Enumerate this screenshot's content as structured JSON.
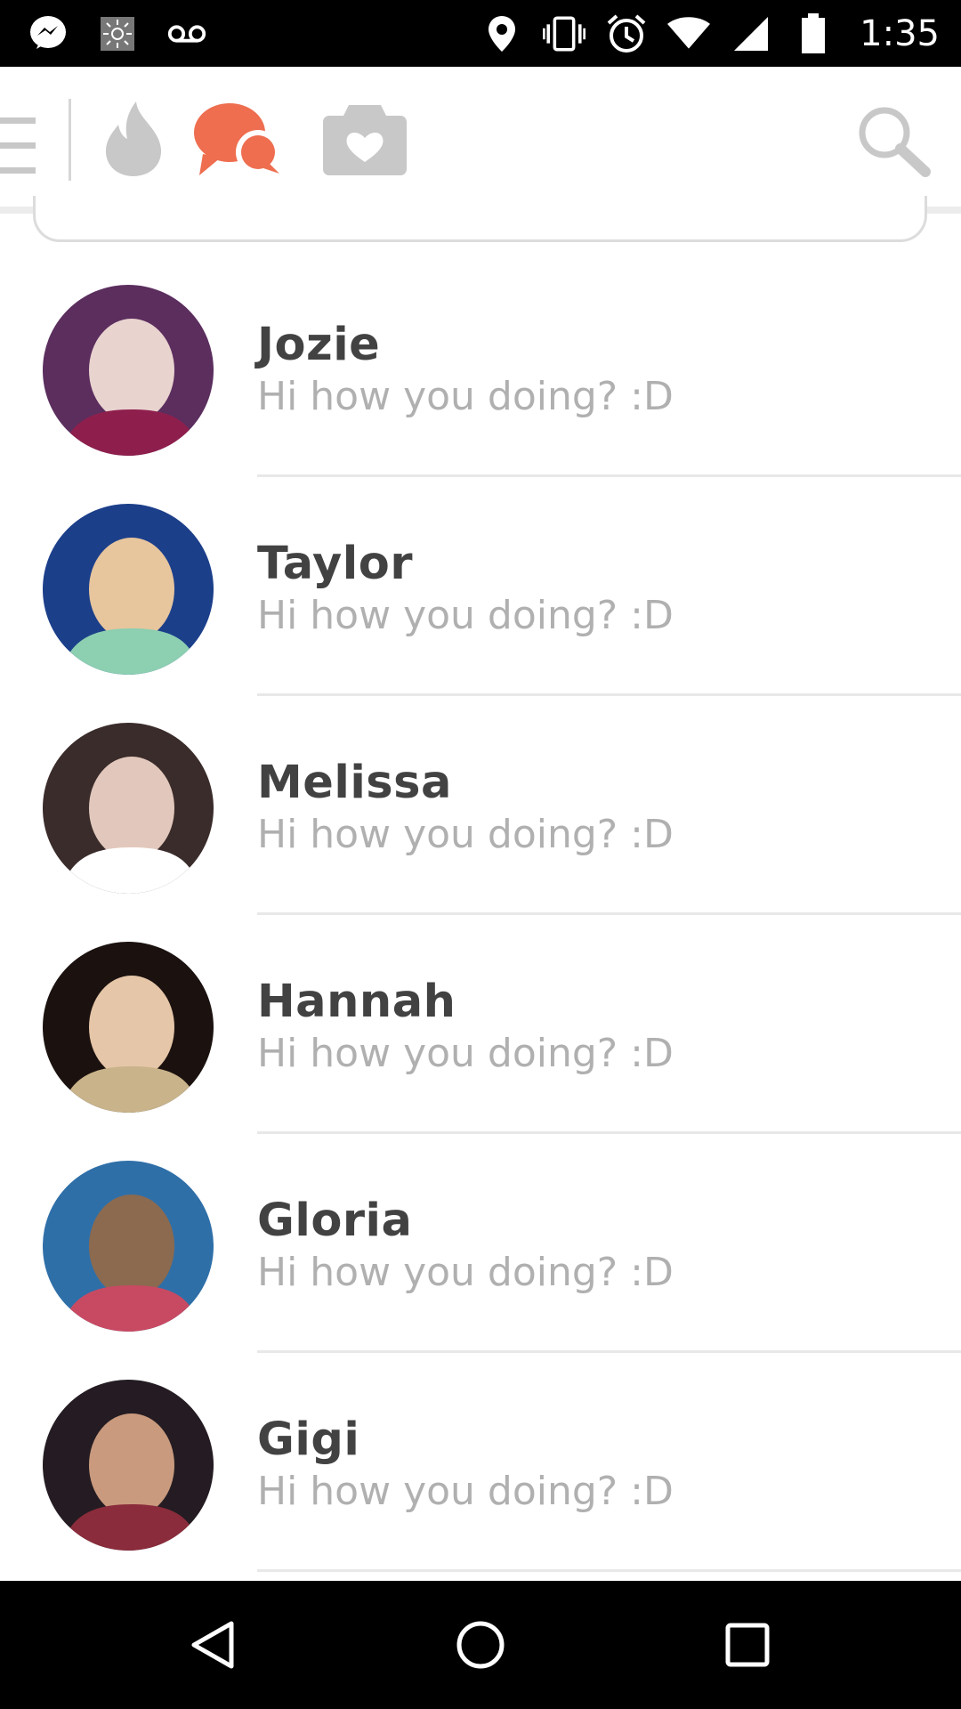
{
  "status_bar": {
    "time": "1:35",
    "left_icons": [
      "messenger-icon",
      "brightness-icon",
      "voicemail-icon"
    ],
    "right_icons": [
      "location-icon",
      "vibrate-icon",
      "alarm-icon",
      "wifi-icon",
      "signal-icon",
      "battery-icon"
    ]
  },
  "nav": {
    "tabs": [
      {
        "name": "flame-tab",
        "icon": "flame-icon",
        "active": false
      },
      {
        "name": "chat-tab",
        "icon": "chat-bubbles-icon",
        "active": true
      },
      {
        "name": "moments-tab",
        "icon": "camera-heart-icon",
        "active": false
      }
    ],
    "accent_color": "#ee6e4f",
    "inactive_color": "#c8c8c8"
  },
  "matches": [
    {
      "name": "Jozie",
      "message": "Hi how you doing? :D",
      "avatar_colors": [
        "#5b2e5e",
        "#e9d3cf",
        "#8e1f4d"
      ]
    },
    {
      "name": "Taylor",
      "message": "Hi how you doing? :D",
      "avatar_colors": [
        "#1c3f8a",
        "#e7c59d",
        "#8ccfb1"
      ]
    },
    {
      "name": "Melissa",
      "message": "Hi how you doing? :D",
      "avatar_colors": [
        "#3a2c2b",
        "#e2c8bc",
        "#ffffff"
      ]
    },
    {
      "name": "Hannah",
      "message": "Hi how you doing? :D",
      "avatar_colors": [
        "#1b1210",
        "#e6c6a8",
        "#c9b38a"
      ]
    },
    {
      "name": "Gloria",
      "message": "Hi how you doing? :D",
      "avatar_colors": [
        "#2f6fa8",
        "#8b6a4f",
        "#c84a62"
      ]
    },
    {
      "name": "Gigi",
      "message": "Hi how you doing? :D",
      "avatar_colors": [
        "#241c22",
        "#c99a7e",
        "#8a2c3b"
      ]
    }
  ]
}
